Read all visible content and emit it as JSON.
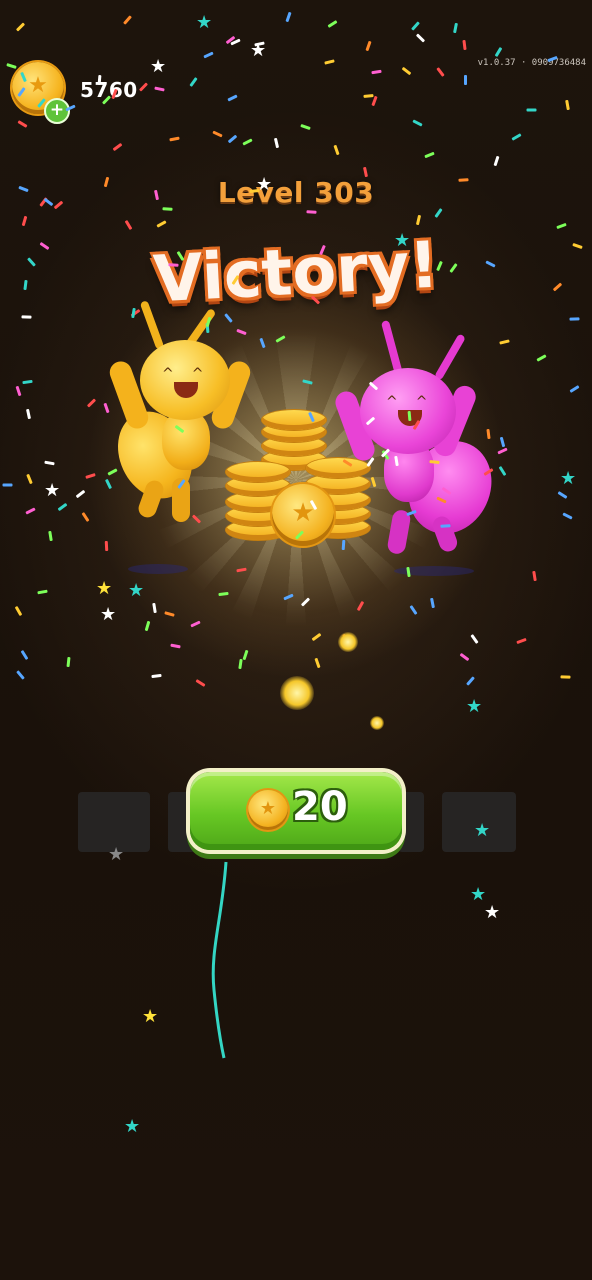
{
  "header": {
    "coins": "5760",
    "version": "v1.0.37 · 0909736484"
  },
  "result": {
    "level": "Level 303",
    "title": "Victory!"
  },
  "reward": {
    "amount": "20"
  },
  "colors": {
    "accent_green": "#67c724",
    "title_orange": "#f3a03b",
    "coin_gold": "#f4b220",
    "yellow_ant": "#f5b51d",
    "pink_ant": "#e63bd3"
  },
  "icons": [
    "coin-icon",
    "plus-icon",
    "star-icon"
  ]
}
